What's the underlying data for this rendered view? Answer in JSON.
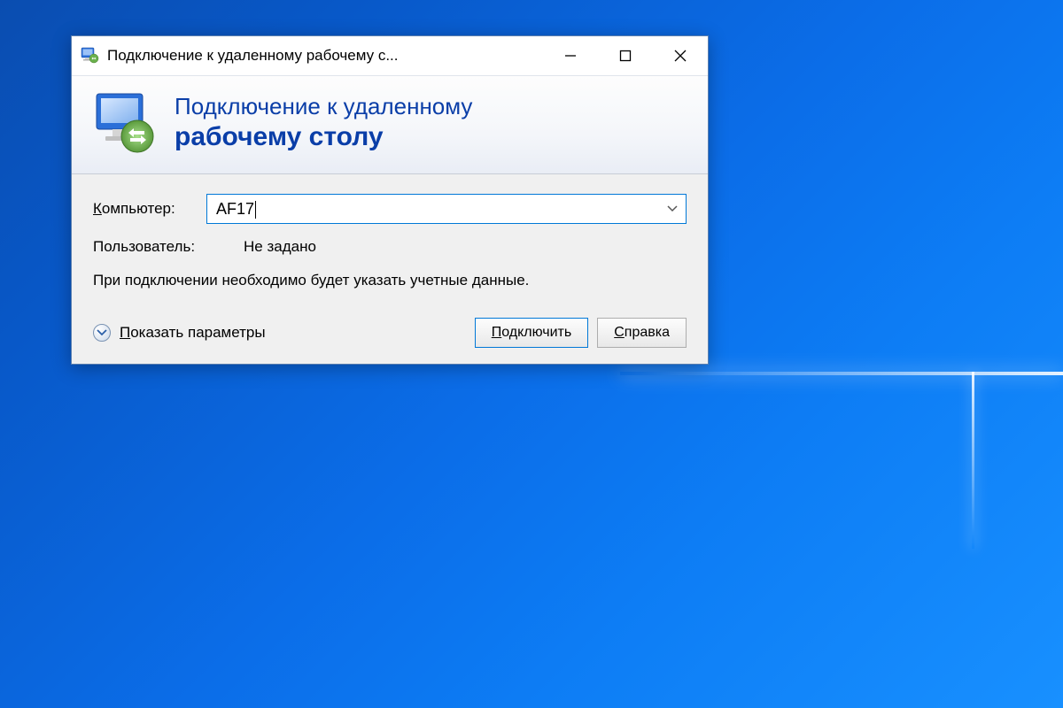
{
  "window": {
    "title": "Подключение к удаленному рабочему с..."
  },
  "header": {
    "line1": "Подключение к удаленному",
    "line2": "рабочему столу"
  },
  "form": {
    "computer_label_u": "К",
    "computer_label_rest": "омпьютер:",
    "computer_value": "AF17",
    "user_label": "Пользователь:",
    "user_value": "Не задано",
    "hint": "При подключении необходимо будет указать учетные данные."
  },
  "footer": {
    "show_options_u": "П",
    "show_options_rest": "оказать параметры",
    "connect_u": "П",
    "connect_rest": "одключить",
    "help_u": "С",
    "help_rest": "правка"
  }
}
